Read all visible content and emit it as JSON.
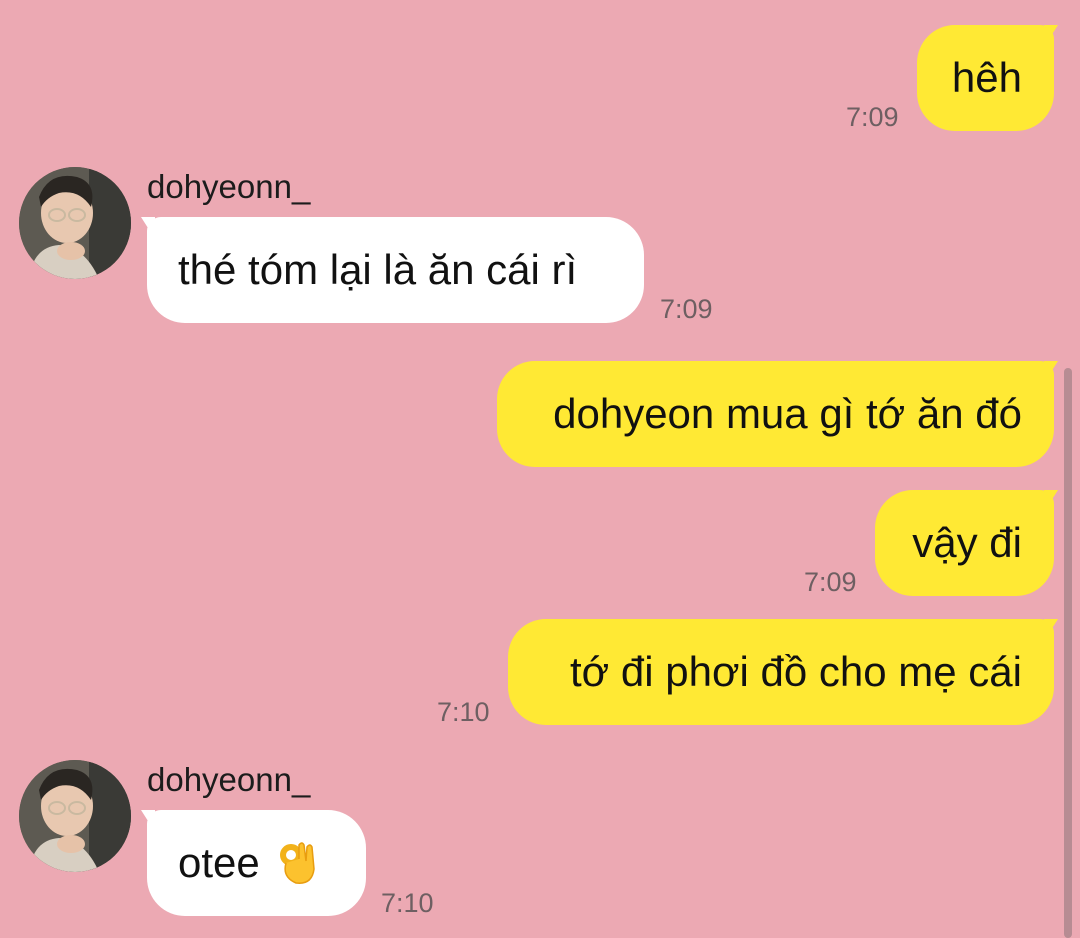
{
  "contact": {
    "name": "dohyeonn_",
    "avatar_icon": "profile-photo"
  },
  "messages": [
    {
      "direction": "out",
      "text": "hêh",
      "time": "7:09"
    },
    {
      "direction": "in",
      "sender": "dohyeonn_",
      "text": "thé tóm lại là ăn cái rì",
      "time": "7:09"
    },
    {
      "direction": "out",
      "text": "dohyeon mua gì tớ ăn đó",
      "time": ""
    },
    {
      "direction": "out",
      "text": "vậy đi",
      "time": "7:09"
    },
    {
      "direction": "out",
      "text": "tớ đi phơi đồ cho mẹ cái",
      "time": "7:10"
    },
    {
      "direction": "in",
      "sender": "dohyeonn_",
      "text": "otee",
      "emoji": "ok-hand-emoji",
      "time": "7:10"
    }
  ],
  "colors": {
    "background": "#eca9b3",
    "outgoing_bubble": "#ffe934",
    "incoming_bubble": "#ffffff",
    "timestamp": "#6e5f62"
  }
}
